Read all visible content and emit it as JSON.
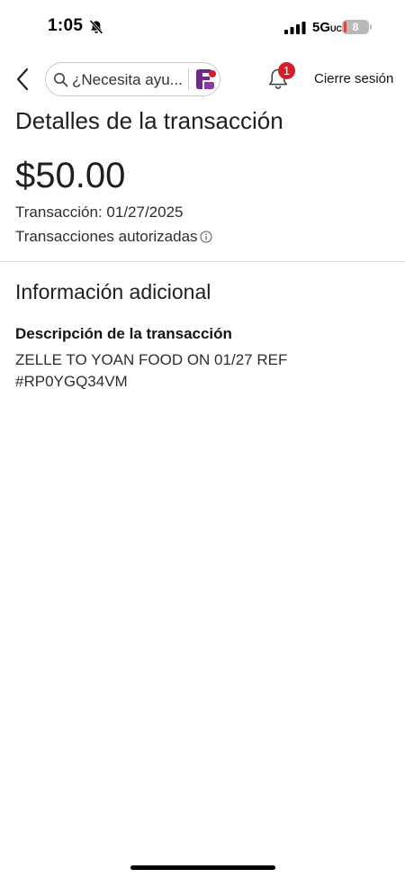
{
  "status_bar": {
    "time": "1:05",
    "network": "5G",
    "network_suffix": "UC",
    "battery": "8",
    "icons": [
      "bell-slash-icon",
      "signal-bars-icon",
      "battery-icon"
    ]
  },
  "nav": {
    "search_placeholder": "¿Necesita ayu...",
    "notification_count": "1",
    "logout_label": "Cierre sesión",
    "icons": [
      "back-chevron-icon",
      "search-icon",
      "assistant-logo-icon",
      "bell-icon"
    ]
  },
  "transaction": {
    "page_title": "Detalles de la transacción",
    "amount": "$50.00",
    "date_line": "Transacción: 01/27/2025",
    "status_label": "Transacciones autorizadas"
  },
  "additional_info": {
    "section_title": "Información adicional",
    "description_label": "Descripción de la transacción",
    "description": "ZELLE TO YOAN FOOD ON 01/27 REF #RP0YGQ34VM"
  },
  "colors": {
    "badge_red": "#d71e28",
    "assistant_purple": "#6b2a8c",
    "text_dark": "#1f1f1f",
    "divider": "#dedede"
  }
}
